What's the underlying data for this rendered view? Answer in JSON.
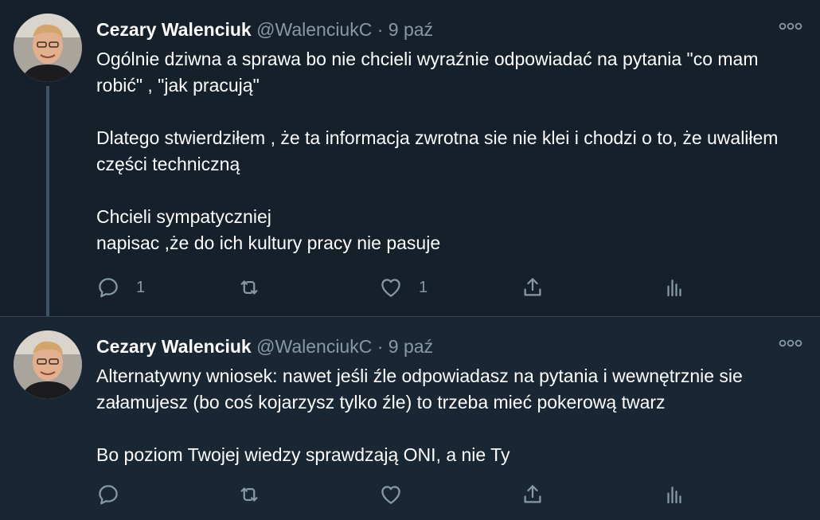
{
  "tweets": [
    {
      "author_name": "Cezary Walenciuk",
      "handle": "@WalenciukC",
      "separator": "·",
      "time": "9 paź",
      "paragraphs": [
        "Ogólnie dziwna a sprawa bo  nie chcieli wyraźnie odpowiadać na  pytania \"co mam robić\" , \"jak pracują\"",
        "Dlatego stwierdziłem , że ta informacja zwrotna sie nie klei i chodzi o to, że uwaliłem części techniczną",
        "Chcieli sympatyczniej\nnapisac ,że do ich kultury pracy nie pasuje"
      ],
      "reply_count": "1",
      "retweet_count": "",
      "like_count": "1"
    },
    {
      "author_name": "Cezary Walenciuk",
      "handle": "@WalenciukC",
      "separator": "·",
      "time": "9 paź",
      "paragraphs": [
        "Alternatywny wniosek: nawet jeśli źle odpowiadasz na pytania i wewnętrznie sie załamujesz (bo coś kojarzysz tylko źle) to trzeba mieć pokerową twarz",
        "Bo poziom Twojej wiedzy sprawdzają ONI, a nie Ty"
      ],
      "reply_count": "",
      "retweet_count": "",
      "like_count": ""
    }
  ],
  "icons": {
    "reply": "reply-icon",
    "retweet": "retweet-icon",
    "like": "heart-icon",
    "share": "share-icon",
    "analytics": "analytics-icon",
    "more": "more-icon"
  },
  "colors": {
    "background": "#15202b",
    "secondary_text": "#8899a6",
    "thread_line": "#3d5466"
  }
}
